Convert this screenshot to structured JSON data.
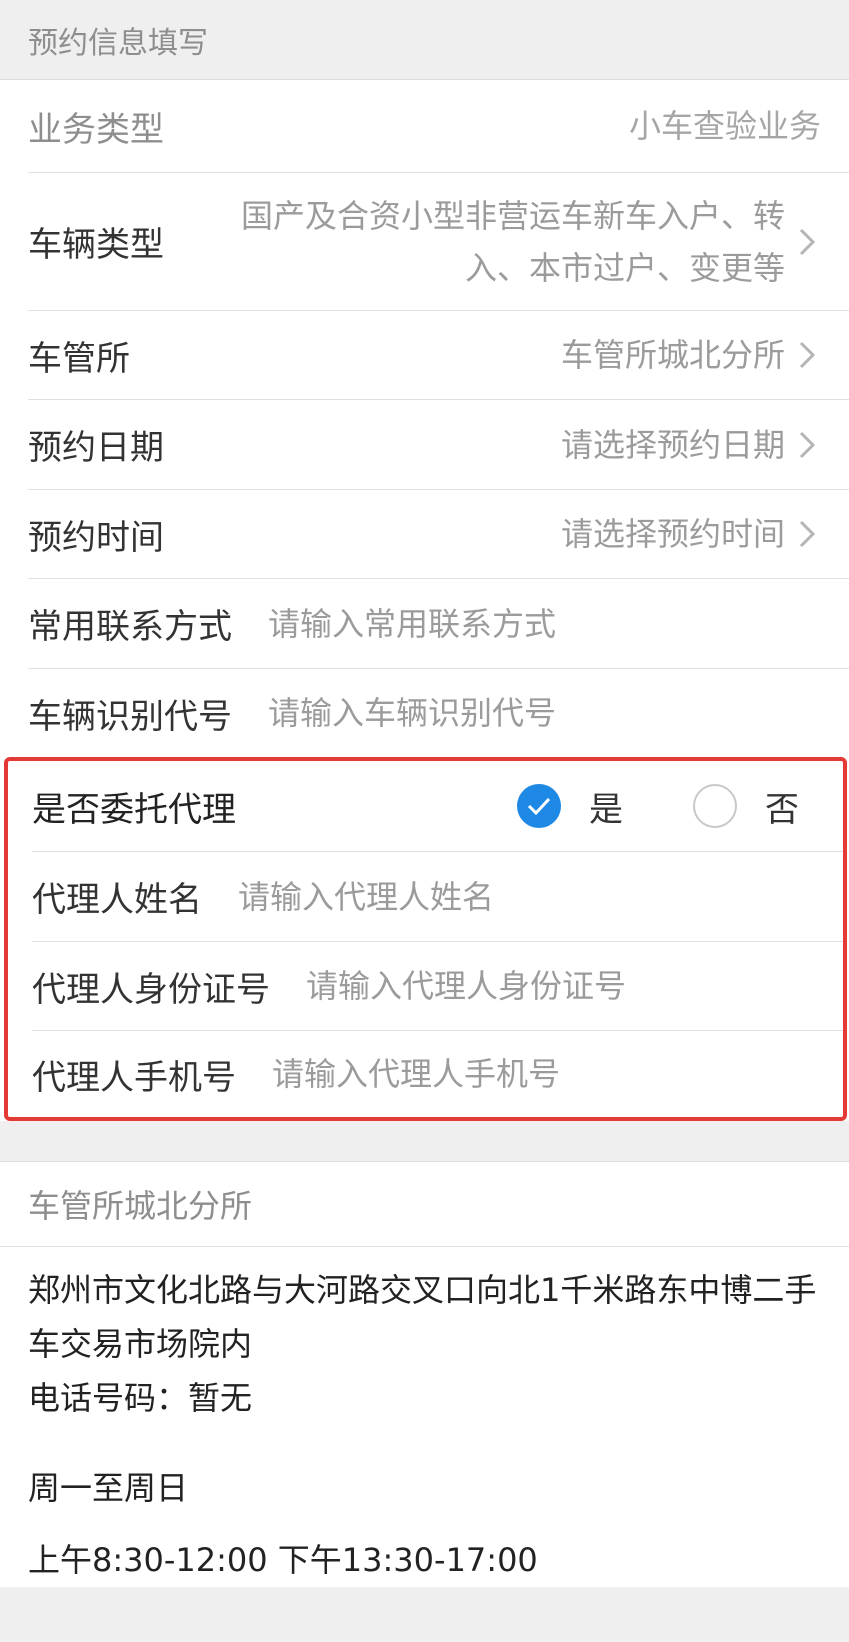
{
  "section_title": "预约信息填写",
  "fields": {
    "business_type": {
      "label": "业务类型",
      "value": "小车查验业务"
    },
    "vehicle_type": {
      "label": "车辆类型",
      "value": "国产及合资小型非营运车新车入户、转入、本市过户、变更等"
    },
    "office": {
      "label": "车管所",
      "value": "车管所城北分所"
    },
    "date": {
      "label": "预约日期",
      "value": "请选择预约日期"
    },
    "time": {
      "label": "预约时间",
      "value": "请选择预约时间"
    },
    "contact": {
      "label": "常用联系方式",
      "placeholder": "请输入常用联系方式"
    },
    "vin": {
      "label": "车辆识别代号",
      "placeholder": "请输入车辆识别代号"
    }
  },
  "agent": {
    "label": "是否委托代理",
    "yes_label": "是",
    "no_label": "否",
    "selected": "是",
    "name": {
      "label": "代理人姓名",
      "placeholder": "请输入代理人姓名"
    },
    "id_number": {
      "label": "代理人身份证号",
      "placeholder": "请输入代理人身份证号"
    },
    "phone": {
      "label": "代理人手机号",
      "placeholder": "请输入代理人手机号"
    }
  },
  "office_info": {
    "title": "车管所城北分所",
    "address": "郑州市文化北路与大河路交叉口向北1千米路东中博二手车交易市场院内",
    "phone": "电话号码：暂无",
    "days": "周一至周日",
    "hours": "上午8:30-12:00 下午13:30-17:00"
  },
  "colors": {
    "accent": "#1e88e5",
    "highlight_border": "#e53935",
    "background": "#efefef"
  }
}
